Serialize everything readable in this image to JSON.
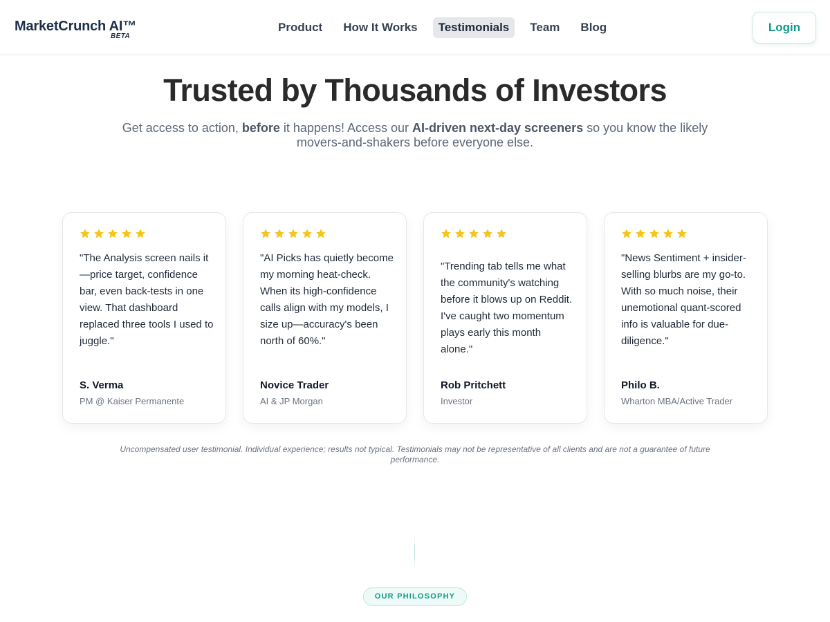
{
  "header": {
    "logo_name": "MarketCrunch AI™",
    "logo_badge": "BETA",
    "nav": [
      {
        "label": "Product",
        "active": false
      },
      {
        "label": "How It Works",
        "active": false
      },
      {
        "label": "Testimonials",
        "active": true
      },
      {
        "label": "Team",
        "active": false
      },
      {
        "label": "Blog",
        "active": false
      }
    ],
    "login_label": "Login"
  },
  "hero": {
    "title": "Trusted by Thousands of Investors",
    "subtitle_parts": [
      "Get access to action, ",
      "before",
      " it happens! Access our ",
      "AI-driven next-day screeners",
      " so you know the likely movers-and-shakers before everyone else."
    ]
  },
  "testimonials": [
    {
      "rating": 5,
      "quote": "\"The Analysis screen nails it—price target, confidence bar, even back-tests in one view. That dashboard replaced three tools I used to juggle.\"",
      "author": "S. Verma",
      "role": "PM @ Kaiser Permanente"
    },
    {
      "rating": 5,
      "quote": "\"AI Picks has quietly become my morning heat-check. When its high-confidence calls align with my models, I size up—accuracy's been north of 60%.\"",
      "author": "Novice Trader",
      "role": "AI & JP Morgan"
    },
    {
      "rating": 5,
      "quote": "\"Trending tab tells me what the community's watching before it blows up on Reddit. I've caught two momentum plays early this month alone.\"",
      "author": "Rob Pritchett",
      "role": "Investor"
    },
    {
      "rating": 5,
      "quote": "\"News Sentiment + insider-selling blurbs are my go-to. With so much noise, their unemotional quant-scored info is valuable for due-diligence.\"",
      "author": "Philo B.",
      "role": "Wharton MBA/Active Trader"
    }
  ],
  "disclaimer": "Uncompensated user testimonial. Individual experience; results not typical. Testimonials may not be representative of all clients and are not a guarantee of future performance.",
  "philosophy_badge": "OUR PHILOSOPHY",
  "colors": {
    "brand_navy": "#1f2f4a",
    "accent_teal": "#0f9a88",
    "star_gold": "#f5c518"
  }
}
